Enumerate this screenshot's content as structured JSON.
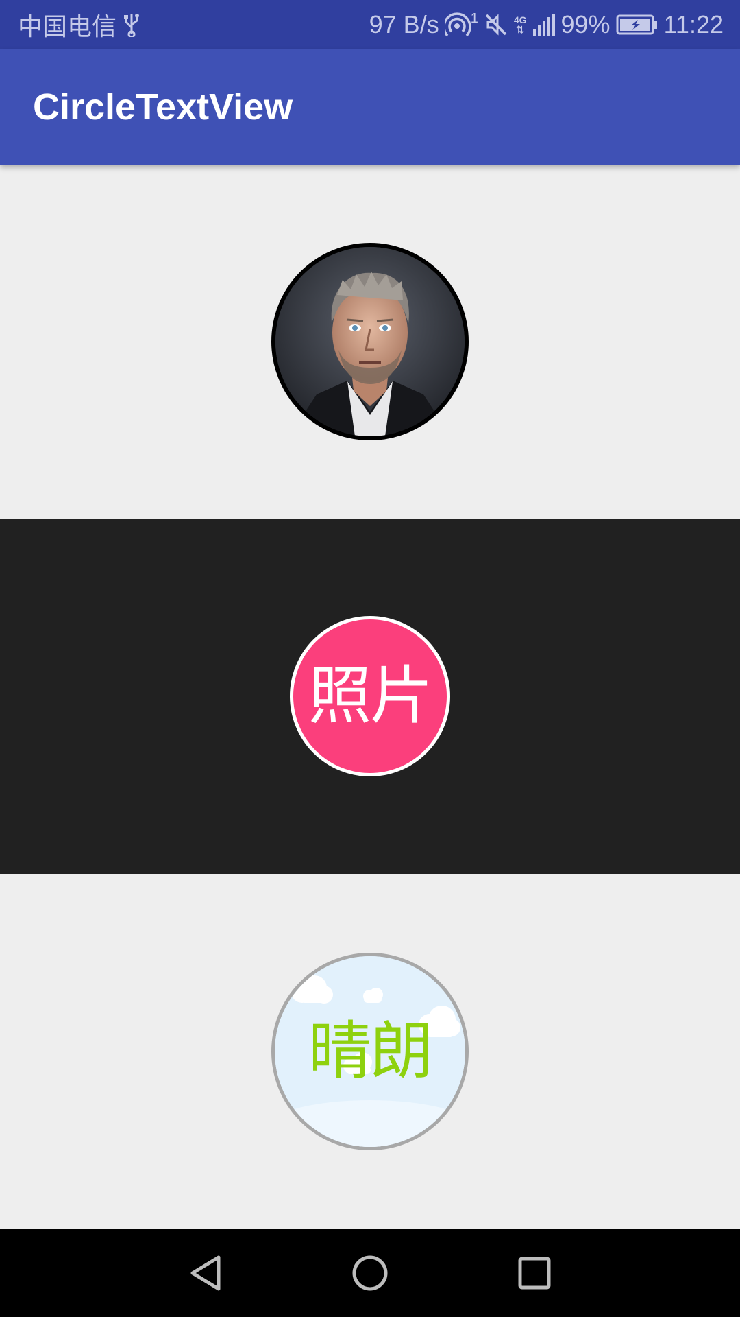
{
  "status_bar": {
    "carrier": "中国电信",
    "usb_icon": "usb-icon",
    "speed": "97 B/s",
    "hotspot_icon": "hotspot-icon",
    "hotspot_count": "1",
    "mute_icon": "mute-icon",
    "network_type": "4G",
    "signal_icon": "signal-icon",
    "battery_percent": "99%",
    "battery_icon": "battery-charging-icon",
    "time": "11:22"
  },
  "app_bar": {
    "title": "CircleTextView",
    "color": "#3f51b5",
    "status_color": "#303f9f"
  },
  "sections": [
    {
      "background": "#eeeeee",
      "kind": "image-circle",
      "border_color": "#000000",
      "icon": "portrait-avatar"
    },
    {
      "background": "#212121",
      "kind": "text-circle",
      "text": "照片",
      "fill": "#fb3f7c",
      "text_color": "#ffffff",
      "border_color": "#ffffff"
    },
    {
      "background": "#eeeeee",
      "kind": "text-circle",
      "text": "晴朗",
      "fill": "#dff0fb",
      "text_color": "#8ed10e",
      "border_color": "#a8a8a8",
      "icon": "sky-clouds-background"
    }
  ],
  "nav_bar": {
    "back_icon": "back-icon",
    "home_icon": "home-icon",
    "recents_icon": "recents-icon"
  }
}
